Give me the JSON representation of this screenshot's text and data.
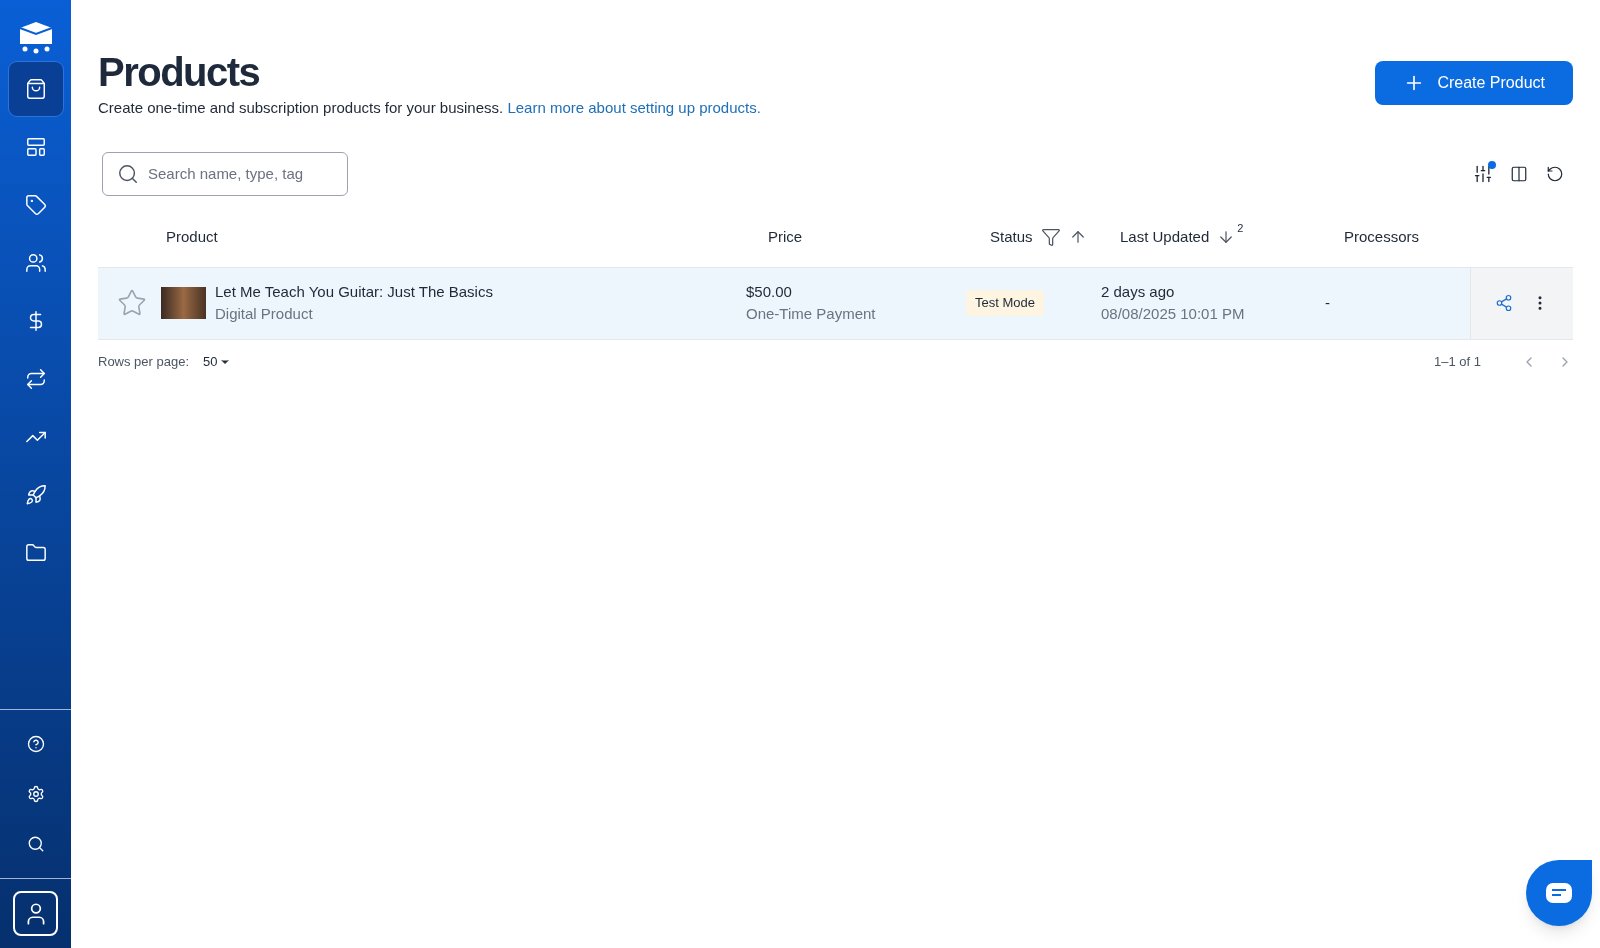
{
  "sidebar": {
    "items": [
      {
        "kind": "bag",
        "selected": true
      },
      {
        "kind": "layout",
        "selected": false
      },
      {
        "kind": "tag",
        "selected": false
      },
      {
        "kind": "users",
        "selected": false
      },
      {
        "kind": "dollar",
        "selected": false
      },
      {
        "kind": "repeat",
        "selected": false
      },
      {
        "kind": "trend",
        "selected": false
      },
      {
        "kind": "rocket",
        "selected": false
      },
      {
        "kind": "folder",
        "selected": false
      }
    ],
    "bottom_items": [
      {
        "kind": "help"
      },
      {
        "kind": "settings"
      },
      {
        "kind": "search"
      }
    ]
  },
  "header": {
    "title": "Products",
    "description": "Create one-time and subscription products for your business.",
    "link": "Learn more about setting up products.",
    "create_button": "Create Product"
  },
  "search": {
    "placeholder": "Search name, type, tag"
  },
  "toolbar": {
    "filters_active": true
  },
  "table": {
    "columns": [
      {
        "label": "Product",
        "filtered": false,
        "sorted": false
      },
      {
        "label": "Price",
        "filtered": false,
        "sorted": false
      },
      {
        "label": "Status",
        "filtered": true,
        "sorted": true,
        "ascending": true
      },
      {
        "label": "Last Updated",
        "filtered": false,
        "sorted": true,
        "ascending": false,
        "sort_order": "2"
      },
      {
        "label": "Processors",
        "filtered": false,
        "sorted": false
      }
    ],
    "rows": [
      {
        "starred": false,
        "name": "Let Me Teach You Guitar: Just The Basics",
        "type": "Digital Product",
        "price": "$50.00",
        "payment": "One-Time Payment",
        "status": "Test Mode",
        "updated": "2 days ago",
        "updated_date": "08/08/2025 10:01 PM",
        "processors": "-"
      }
    ]
  },
  "pagination": {
    "rows_per_page_label": "Rows per page:",
    "rows_per_page": "50",
    "range": "1–1 of 1"
  }
}
